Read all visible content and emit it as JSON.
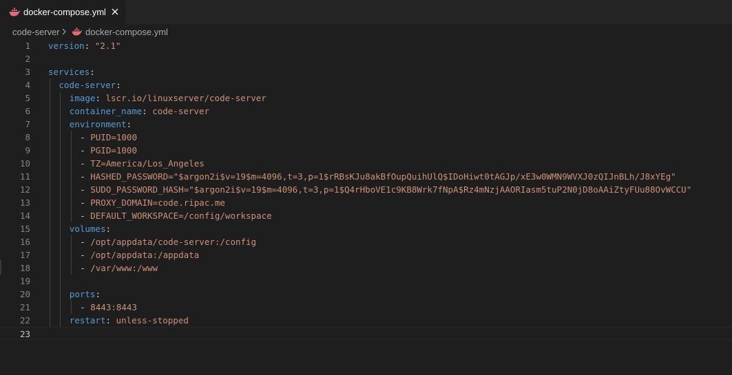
{
  "tab": {
    "filename": "docker-compose.yml",
    "close_icon": "close-icon",
    "file_icon": "docker-icon"
  },
  "breadcrumb": {
    "folder": "code-server",
    "file": "docker-compose.yml"
  },
  "colors": {
    "key": "#569cd6",
    "value": "#ce9178",
    "punct": "#d4d4d4",
    "line_number": "#858585",
    "background": "#1e1e1e",
    "tab_icon": "#e06c75"
  },
  "editor": {
    "current_line": 23,
    "lines": [
      {
        "n": "1",
        "k": "version",
        "p": ": ",
        "v": "\"2.1\""
      },
      {
        "n": "2"
      },
      {
        "n": "3",
        "k": "services",
        "p": ":"
      },
      {
        "n": "4",
        "k": "code-server",
        "p": ":"
      },
      {
        "n": "5",
        "k": "image",
        "p": ": ",
        "v": "lscr.io/linuxserver/code-server"
      },
      {
        "n": "6",
        "k": "container_name",
        "p": ": ",
        "v": "code-server"
      },
      {
        "n": "7",
        "k": "environment",
        "p": ":"
      },
      {
        "n": "8",
        "p": "- ",
        "v": "PUID=1000"
      },
      {
        "n": "9",
        "p": "- ",
        "v": "PGID=1000"
      },
      {
        "n": "10",
        "p": "- ",
        "v": "TZ=America/Los_Angeles"
      },
      {
        "n": "11",
        "p": "- ",
        "v": "HASHED_PASSWORD=\"$argon2i$v=19$m=4096,t=3,p=1$rRBsKJu8akBfOupQuihUlQ$IDoHiwt0tAGJp/xE3w0WMN9WVXJ0zQIJnBLh/J8xYEg\""
      },
      {
        "n": "12",
        "p": "- ",
        "v": "SUDO_PASSWORD_HASH=\"$argon2i$v=19$m=4096,t=3,p=1$Q4rHboVE1c9KB8Wrk7fNpA$Rz4mNzjAAORIasm5tuP2N0jD8oAAiZtyFUu88OvWCCU\""
      },
      {
        "n": "13",
        "p": "- ",
        "v": "PROXY_DOMAIN=code.ripac.me"
      },
      {
        "n": "14",
        "p": "- ",
        "v": "DEFAULT_WORKSPACE=/config/workspace"
      },
      {
        "n": "15",
        "k": "volumes",
        "p": ":"
      },
      {
        "n": "16",
        "p": "- ",
        "v": "/opt/appdata/code-server:/config"
      },
      {
        "n": "17",
        "p": "- ",
        "v": "/opt/appdata:/appdata"
      },
      {
        "n": "18",
        "p": "- ",
        "v": "/var/www:/www"
      },
      {
        "n": "19"
      },
      {
        "n": "20",
        "k": "ports",
        "p": ":"
      },
      {
        "n": "21",
        "p": "- ",
        "v": "8443:8443"
      },
      {
        "n": "22",
        "k": "restart",
        "p": ": ",
        "v": "unless-stopped"
      },
      {
        "n": "23"
      }
    ]
  }
}
